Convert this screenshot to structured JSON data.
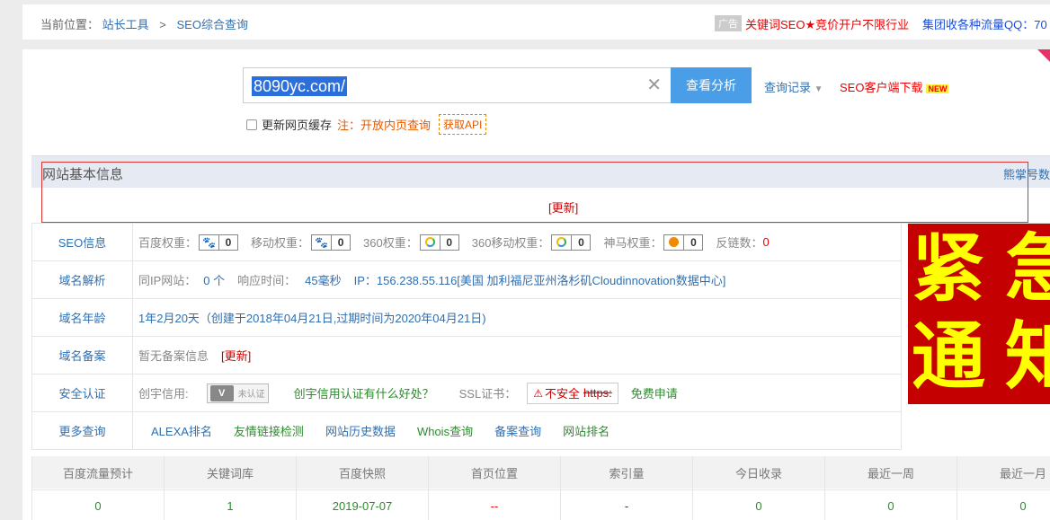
{
  "breadcrumb": {
    "prefix": "当前位置：",
    "home": "站长工具",
    "separator": ">",
    "current": "SEO综合查询"
  },
  "top_ads": {
    "tag": "广告",
    "red_text": "关键词SEO★竞价开户不限行业",
    "blue_text": "集团收各种流量QQ：70"
  },
  "search": {
    "value": "8090yc.com/",
    "clear_icon": "close-icon",
    "analyze_label": "查看分析",
    "history_label": "查询记录",
    "client_download": "SEO客户端下载",
    "new_badge": "NEW"
  },
  "options": {
    "refresh_cache_label": "更新网页缓存",
    "note": "注：开放内页查询",
    "api_label": "获取API"
  },
  "basic_info": {
    "title": "网站基本信息",
    "right_link": "熊掌号数",
    "update_label": "[更新]"
  },
  "seo_info": {
    "label": "SEO信息",
    "baidu_label": "百度权重：",
    "baidu_value": "0",
    "mobile_label": "移动权重：",
    "mobile_value": "0",
    "s360_label": "360权重：",
    "s360_value": "0",
    "s360m_label": "360移动权重：",
    "s360m_value": "0",
    "shenma_label": "神马权重：",
    "shenma_value": "0",
    "backlink_label": "反链数：",
    "backlink_value": "0"
  },
  "dns": {
    "label": "域名解析",
    "same_ip_label": "同IP网站：",
    "same_ip_value": "0 个",
    "response_label": "响应时间：",
    "response_value": "45毫秒",
    "ip_text": "IP：156.238.55.116[美国 加利福尼亚州洛杉矶Cloudinnovation数据中心]"
  },
  "age": {
    "label": "域名年龄",
    "value": "1年2月20天（创建于2018年04月21日,过期时间为2020年04月21日)"
  },
  "icp": {
    "label": "域名备案",
    "value": "暂无备案信息",
    "update": "[更新]"
  },
  "security": {
    "label": "安全认证",
    "credit_label": "创宇信用:",
    "cert_text": "未认证",
    "credit_link": "创宇信用认证有什么好处？",
    "ssl_label": "SSL证书：",
    "ssl_status": "不安全",
    "ssl_https": "https:",
    "free_apply": "免费申请"
  },
  "more": {
    "label": "更多查询",
    "links": [
      "ALEXA排名",
      "友情链接检测",
      "网站历史数据",
      "Whois查询",
      "备案查询",
      "网站排名"
    ]
  },
  "banner": {
    "chars": [
      "紧",
      "急",
      "通",
      "知"
    ]
  },
  "stats": {
    "headers": [
      "百度流量预计",
      "关键词库",
      "百度快照",
      "首页位置",
      "索引量",
      "今日收录",
      "最近一周",
      "最近一月"
    ],
    "values": [
      "0",
      "1",
      "2019-07-07",
      "--",
      "-",
      "0",
      "0",
      "0"
    ]
  },
  "colors": {
    "analyze_button": "#4a9ee8",
    "link_blue": "#2f6fb0",
    "alert_red": "#e00000",
    "banner_red": "#c40000",
    "banner_yellow": "#ffff00"
  }
}
